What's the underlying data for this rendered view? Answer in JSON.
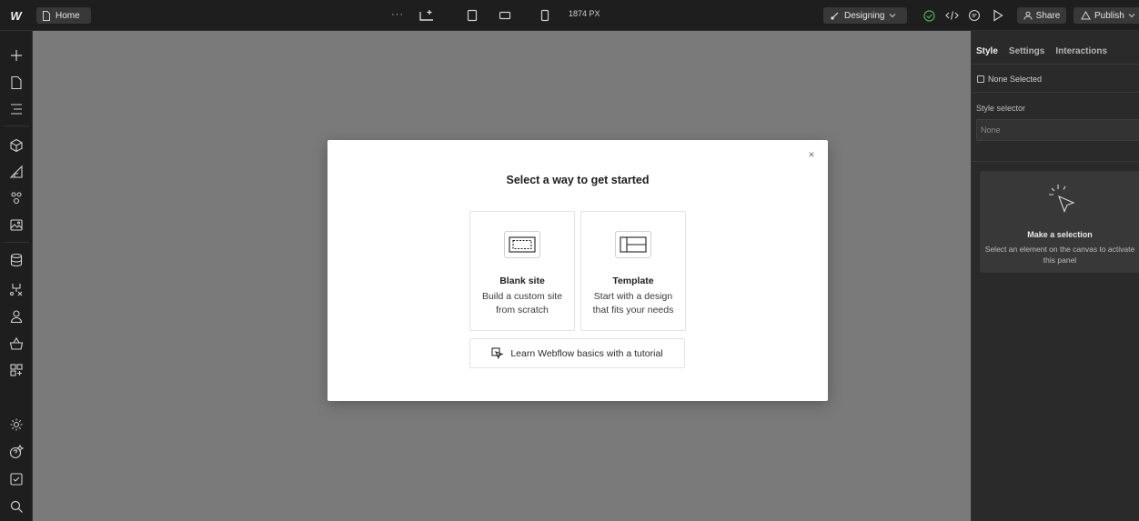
{
  "topbar": {
    "logo_text": "W",
    "page_name": "Home",
    "more_label": "···",
    "width_label": "1874 PX",
    "mode_label": "Designing",
    "share_label": "Share",
    "publish_label": "Publish"
  },
  "modal": {
    "title": "Select a way to get started",
    "close_glyph": "×",
    "cards": [
      {
        "title": "Blank site",
        "description": "Build a custom site from scratch"
      },
      {
        "title": "Template",
        "description": "Start with a design that fits your needs"
      }
    ],
    "tutorial_label": "Learn Webflow basics with a tutorial"
  },
  "right_panel": {
    "tabs": [
      "Style",
      "Settings",
      "Interactions"
    ],
    "active_tab": "Style",
    "none_selected": "None Selected",
    "style_selector_label": "Style selector",
    "style_selector_placeholder": "None",
    "empty_title": "Make a selection",
    "empty_desc": "Select an element on the canvas to activate this panel"
  },
  "colors": {
    "canvas": "#7a7a7a",
    "chrome": "#1e1e1e",
    "panel": "#2a2a2a",
    "success": "#4caf50"
  }
}
